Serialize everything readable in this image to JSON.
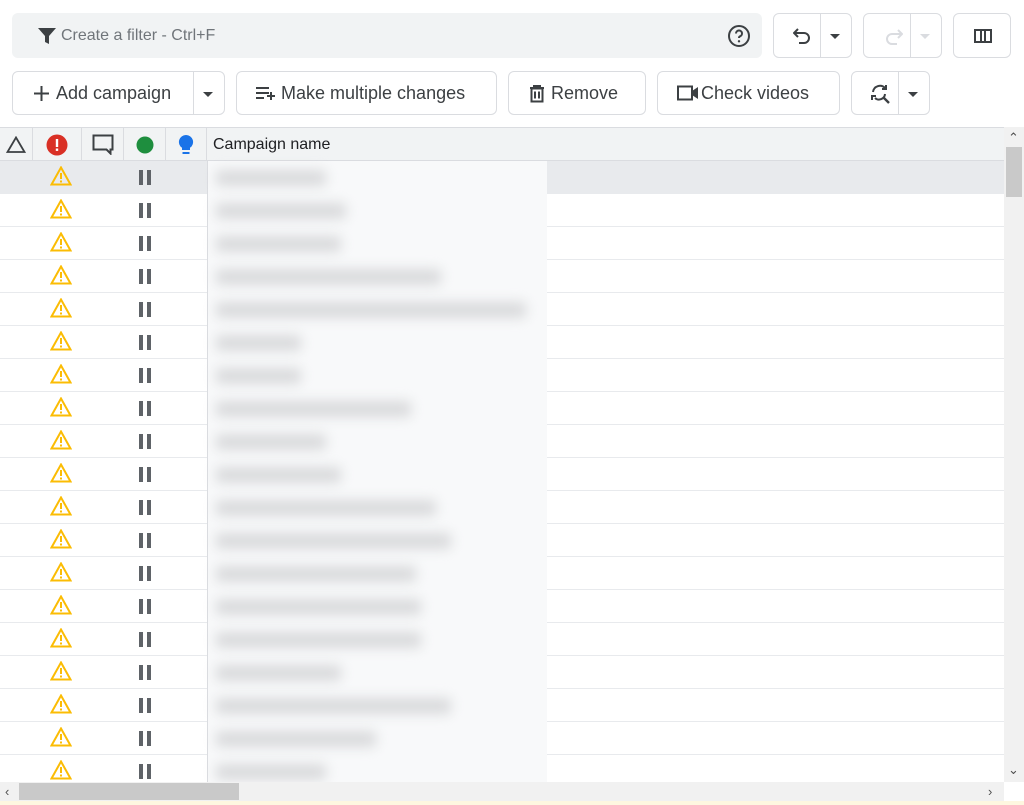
{
  "filter": {
    "placeholder": "Create a filter - Ctrl+F",
    "value": ""
  },
  "toolbar": {
    "add_campaign": "Add campaign",
    "make_multiple_changes": "Make multiple changes",
    "remove": "Remove",
    "check_videos": "Check videos"
  },
  "grid": {
    "header": {
      "campaign_name": "Campaign name"
    },
    "icon_columns": [
      "notifications-triangle",
      "errors",
      "comments",
      "status",
      "recommendations"
    ],
    "colors": {
      "error": "#d93025",
      "status": "#1e8e3e",
      "recommendation": "#1a73e8",
      "warning": "#fbbc04"
    },
    "rows": [
      {
        "warning": true,
        "status": "paused",
        "name": "(blurred)",
        "selected": true
      },
      {
        "warning": true,
        "status": "paused",
        "name": "(blurred)"
      },
      {
        "warning": true,
        "status": "paused",
        "name": "(blurred)"
      },
      {
        "warning": true,
        "status": "paused",
        "name": "(blurred)"
      },
      {
        "warning": true,
        "status": "paused",
        "name": "(blurred)"
      },
      {
        "warning": true,
        "status": "paused",
        "name": "(blurred)"
      },
      {
        "warning": true,
        "status": "paused",
        "name": "(blurred)"
      },
      {
        "warning": true,
        "status": "paused",
        "name": "(blurred)"
      },
      {
        "warning": true,
        "status": "paused",
        "name": "(blurred)"
      },
      {
        "warning": true,
        "status": "paused",
        "name": "(blurred)"
      },
      {
        "warning": true,
        "status": "paused",
        "name": "(blurred)"
      },
      {
        "warning": true,
        "status": "paused",
        "name": "(blurred)"
      },
      {
        "warning": true,
        "status": "paused",
        "name": "(blurred)"
      },
      {
        "warning": true,
        "status": "paused",
        "name": "(blurred)"
      },
      {
        "warning": true,
        "status": "paused",
        "name": "(blurred)"
      },
      {
        "warning": true,
        "status": "paused",
        "name": "(blurred)"
      },
      {
        "warning": true,
        "status": "paused",
        "name": "(blurred)"
      },
      {
        "warning": true,
        "status": "paused",
        "name": "(blurred)"
      },
      {
        "warning": true,
        "status": "paused",
        "name": "(blurred)"
      }
    ]
  }
}
